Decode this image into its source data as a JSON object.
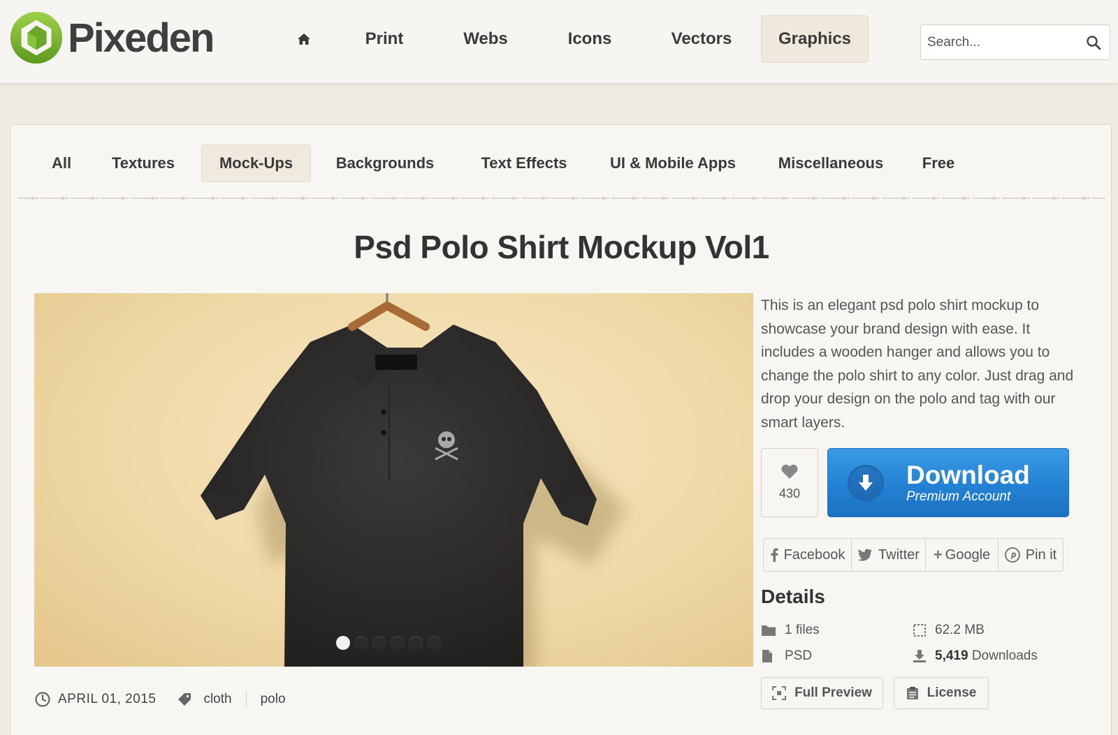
{
  "header": {
    "logo_text": "Pixeden",
    "nav": [
      {
        "label": "Print",
        "active": false
      },
      {
        "label": "Webs",
        "active": false
      },
      {
        "label": "Icons",
        "active": false
      },
      {
        "label": "Vectors",
        "active": false
      },
      {
        "label": "Graphics",
        "active": true
      }
    ],
    "search_placeholder": "Search..."
  },
  "categories": [
    {
      "label": "All",
      "active": false
    },
    {
      "label": "Textures",
      "active": false
    },
    {
      "label": "Mock-Ups",
      "active": true
    },
    {
      "label": "Backgrounds",
      "active": false
    },
    {
      "label": "Text Effects",
      "active": false
    },
    {
      "label": "UI & Mobile Apps",
      "active": false
    },
    {
      "label": "Miscellaneous",
      "active": false
    },
    {
      "label": "Free",
      "active": false
    }
  ],
  "page_title": "Psd Polo Shirt Mockup Vol1",
  "carousel": {
    "slide_count": 6,
    "active_index": 0
  },
  "meta": {
    "date": "APRIL 01, 2015",
    "tags": [
      "cloth",
      "polo"
    ]
  },
  "description": "This is an elegant psd polo shirt mockup to showcase your brand design with ease. It includes a wooden hanger and allows you to change the polo shirt to any color. Just drag and drop your design on the polo and tag with our smart layers.",
  "likes": {
    "count": "430",
    "icon": "heart-icon"
  },
  "download": {
    "title": "Download",
    "subtitle": "Premium Account",
    "icon": "download-arrow-icon",
    "color": "#2381d3"
  },
  "social": [
    {
      "label": "Facebook",
      "icon": "facebook-icon"
    },
    {
      "label": "Twitter",
      "icon": "twitter-icon"
    },
    {
      "label": "Google",
      "icon": "google-plus-icon"
    },
    {
      "label": "Pin it",
      "icon": "pinterest-icon"
    }
  ],
  "details": {
    "title": "Details",
    "files": "1 files",
    "size": "62.2 MB",
    "format": "PSD",
    "downloads_count": "5,419",
    "downloads_label": "Downloads"
  },
  "actions": {
    "full_preview": "Full Preview",
    "license": "License"
  },
  "colors": {
    "brand_green": "#7cb82f",
    "download_blue": "#2381d3",
    "background": "#f0ebe2"
  }
}
